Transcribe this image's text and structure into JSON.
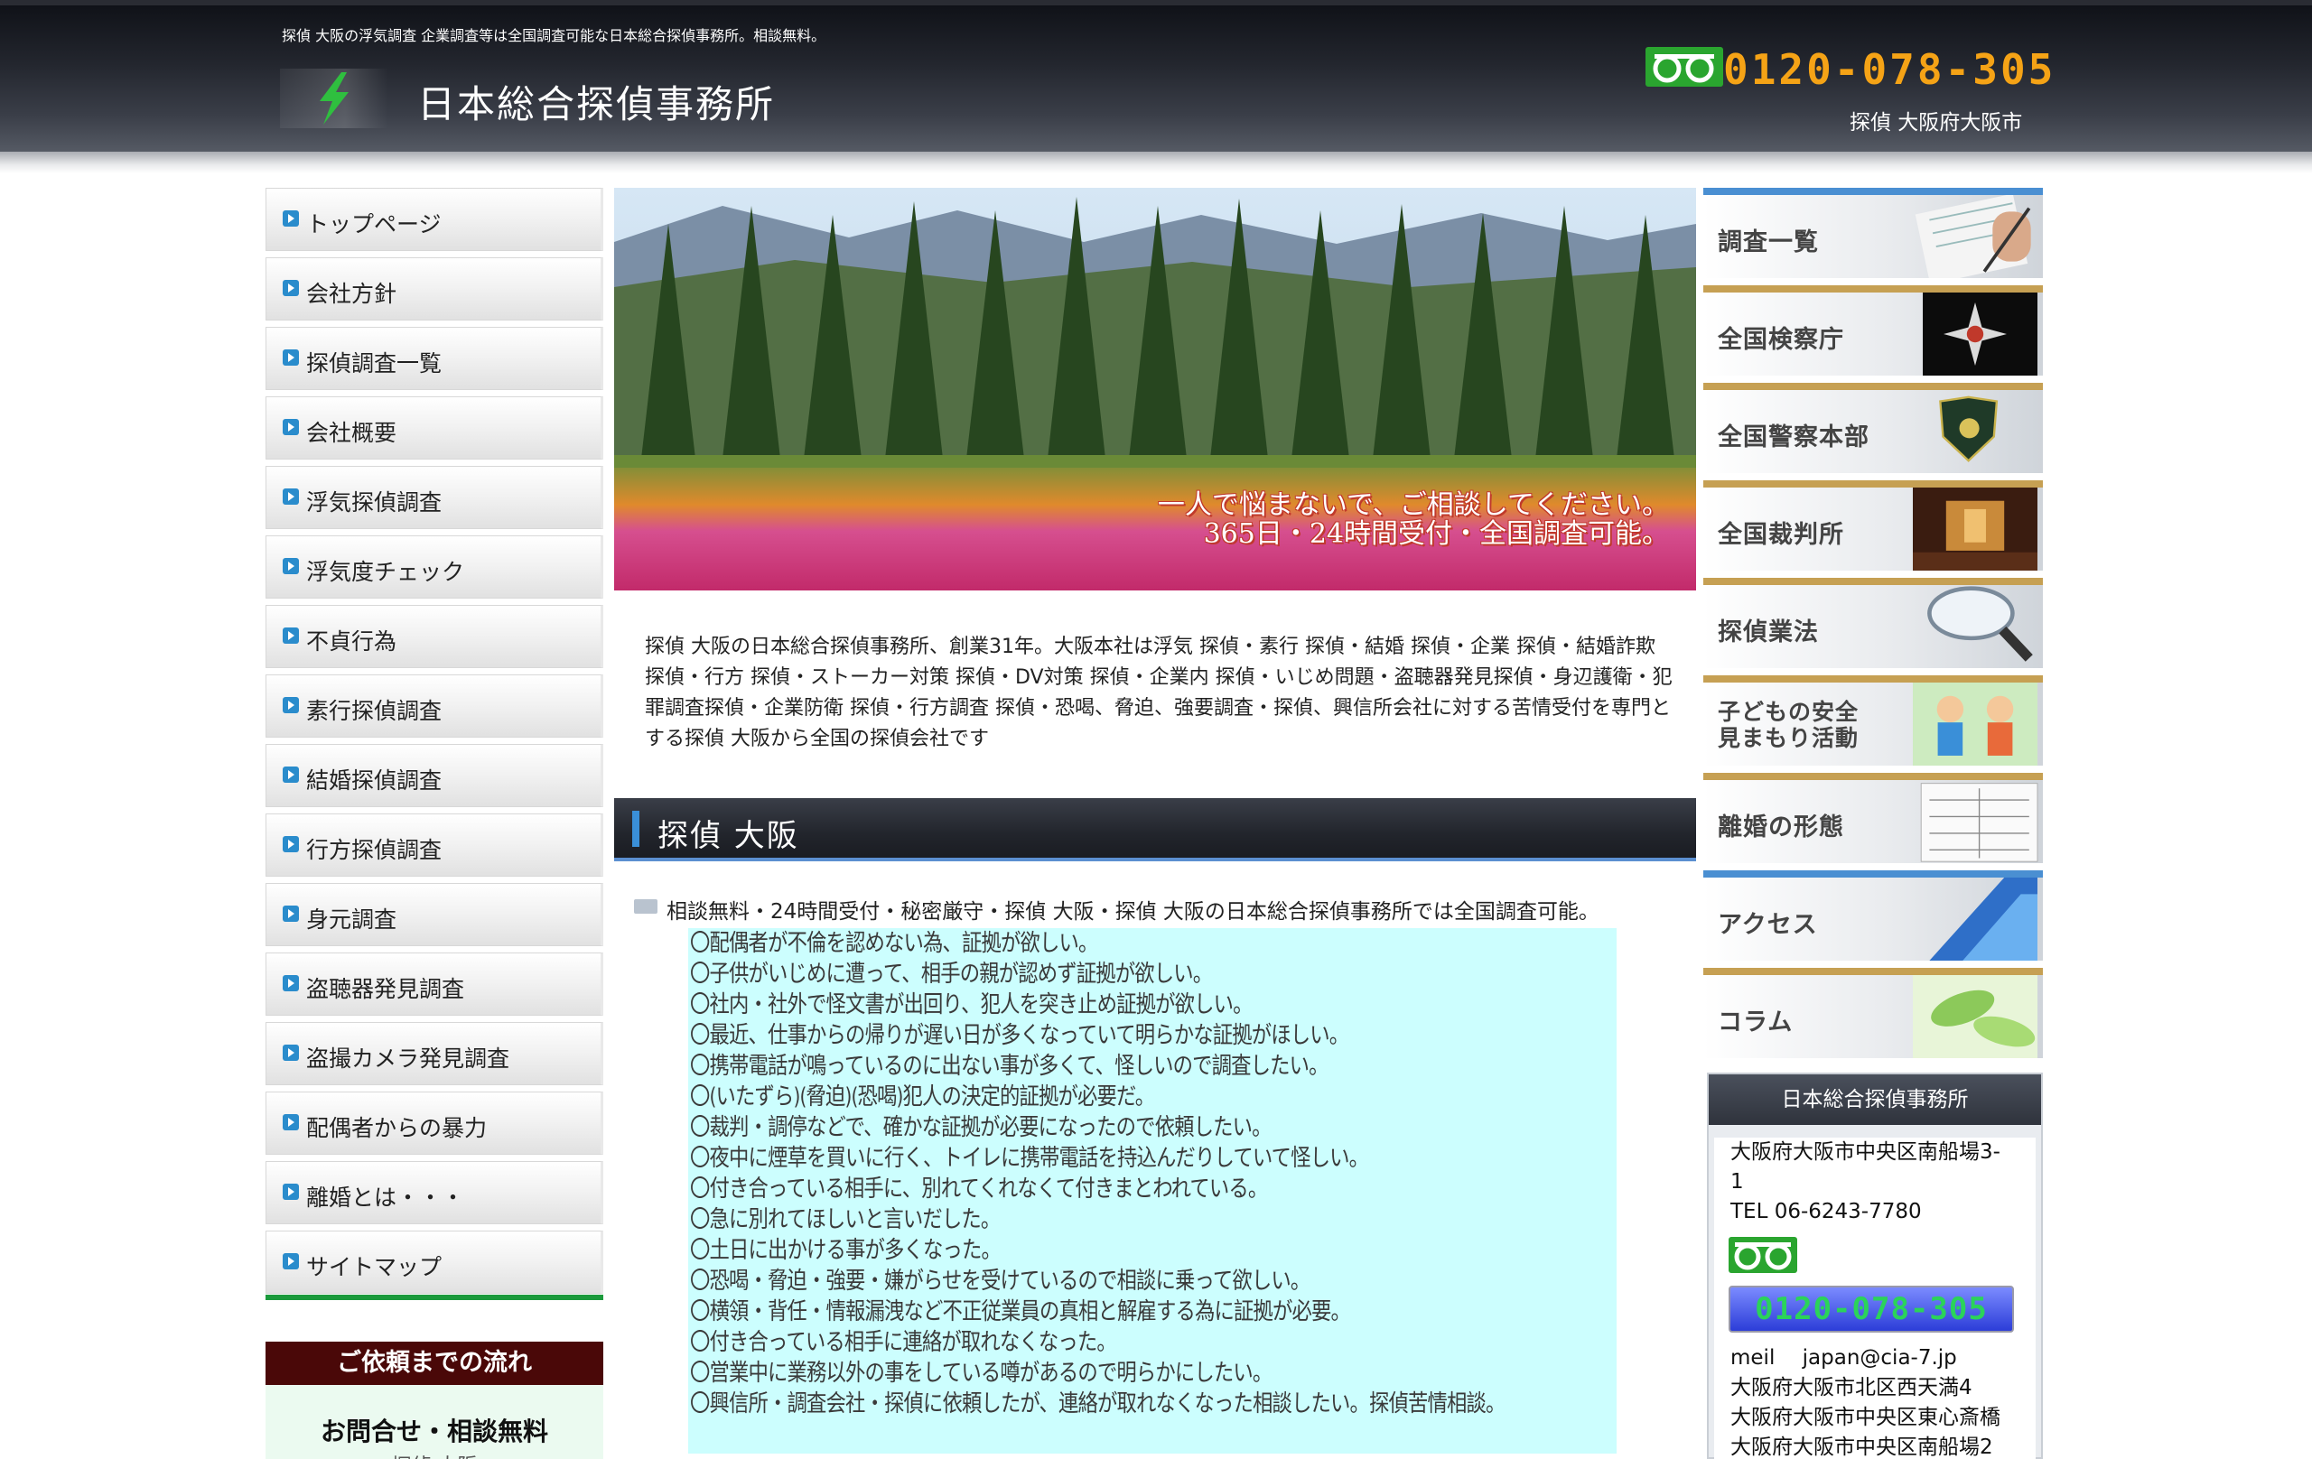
{
  "header": {
    "tagline": "探偵 大阪の浮気調査 企業調査等は全国調査可能な日本総合探偵事務所。相談無料。",
    "site_name": "日本総合探偵事務所",
    "phone": "0120-078-305",
    "location": "探偵 大阪府大阪市",
    "brand_color": "#f5a316"
  },
  "nav": {
    "items": [
      {
        "label": "トップページ"
      },
      {
        "label": "会社方針"
      },
      {
        "label": "探偵調査一覧"
      },
      {
        "label": "会社概要"
      },
      {
        "label": "浮気探偵調査"
      },
      {
        "label": "浮気度チェック"
      },
      {
        "label": "不貞行為"
      },
      {
        "label": "素行探偵調査"
      },
      {
        "label": "結婚探偵調査"
      },
      {
        "label": "行方探偵調査"
      },
      {
        "label": "身元調査"
      },
      {
        "label": "盗聴器発見調査"
      },
      {
        "label": "盗撮カメラ発見調査"
      },
      {
        "label": "配偶者からの暴力"
      },
      {
        "label": "離婚とは・・・"
      },
      {
        "label": "サイトマップ"
      }
    ],
    "flow_title": "ご依頼までの流れ",
    "flow_line1": "お問合せ・相談無料",
    "flow_line2": "探偵 大阪"
  },
  "hero": {
    "line1": "一人で悩まないで、ご相談してください。",
    "line2": "365日・24時間受付・全国調査可能。"
  },
  "main": {
    "intro": "探偵 大阪の日本総合探偵事務所、創業31年。大阪本社は浮気 探偵・素行 探偵・結婚 探偵・企業 探偵・結婚詐欺 探偵・行方 探偵・ストーカー対策 探偵・DV対策 探偵・企業内 探偵・いじめ問題・盗聴器発見探偵・身辺護衛・犯罪調査探偵・企業防衛 探偵・行方調査 探偵・恐喝、脅迫、強要調査・探偵、興信所会社に対する苦情受付を専門とする探偵 大阪から全国の探偵会社です",
    "section_title": "探偵 大阪",
    "lead": "相談無料・24時間受付・秘密厳守・探偵 大阪・探偵 大阪の日本総合探偵事務所では全国調査可能。",
    "items": [
      "〇配偶者が不倫を認めない為、証拠が欲しい。",
      "〇子供がいじめに遭って、相手の親が認めず証拠が欲しい。",
      "〇社内・社外で怪文書が出回り、犯人を突き止め証拠が欲しい。",
      "〇最近、仕事からの帰りが遅い日が多くなっていて明らかな証拠がほしい。",
      "〇携帯電話が鳴っているのに出ない事が多くて、怪しいので調査したい。",
      "〇(いたずら)(脅迫)(恐喝)犯人の決定的証拠が必要だ。",
      "〇裁判・調停などで、確かな証拠が必要になったので依頼したい。",
      "〇夜中に煙草を買いに行く、トイレに携帯電話を持込んだりしていて怪しい。",
      "〇付き合っている相手に、別れてくれなくて付きまとわれている。",
      "〇急に別れてほしいと言いだした。",
      "〇土日に出かける事が多くなった。",
      "〇恐喝・脅迫・強要・嫌がらせを受けているので相談に乗って欲しい。",
      "〇横領・背任・情報漏洩など不正従業員の真相と解雇する為に証拠が必要。",
      "〇付き合っている相手に連絡が取れなくなった。",
      "〇営業中に業務以外の事をしている噂があるので明らかにしたい。",
      "〇興信所・調査会社・探偵に依頼したが、連絡が取れなくなった相談したい。探偵苦情相談。"
    ]
  },
  "sidebar": {
    "banners": [
      {
        "label": "調査一覧",
        "icon": "notebook-pen-icon"
      },
      {
        "label": "全国検察庁",
        "icon": "prosecutor-emblem-icon"
      },
      {
        "label": "全国警察本部",
        "icon": "police-badge-icon"
      },
      {
        "label": "全国裁判所",
        "icon": "courtroom-icon"
      },
      {
        "label": "探偵業法",
        "icon": "magnifier-icon"
      },
      {
        "label": "子どもの安全\n見まもり活動",
        "icon": "children-icon"
      },
      {
        "label": "離婚の形態",
        "icon": "form-document-icon"
      },
      {
        "label": "アクセス",
        "icon": "building-icon"
      },
      {
        "label": "コラム",
        "icon": "leaves-icon"
      }
    ],
    "office": {
      "title": "日本総合探偵事務所",
      "address1": "大阪府大阪市中央区南船場3-",
      "address2": "1",
      "tel": "TEL 06-6243-7780",
      "free_phone": "0120-078-305",
      "mail": "meil　 japan@cia-7.jp",
      "branch1": "大阪府大阪市北区西天満4",
      "branch2": "大阪府大阪市中央区東心斎橋",
      "branch3": "大阪府大阪市中央区南船場2"
    }
  }
}
